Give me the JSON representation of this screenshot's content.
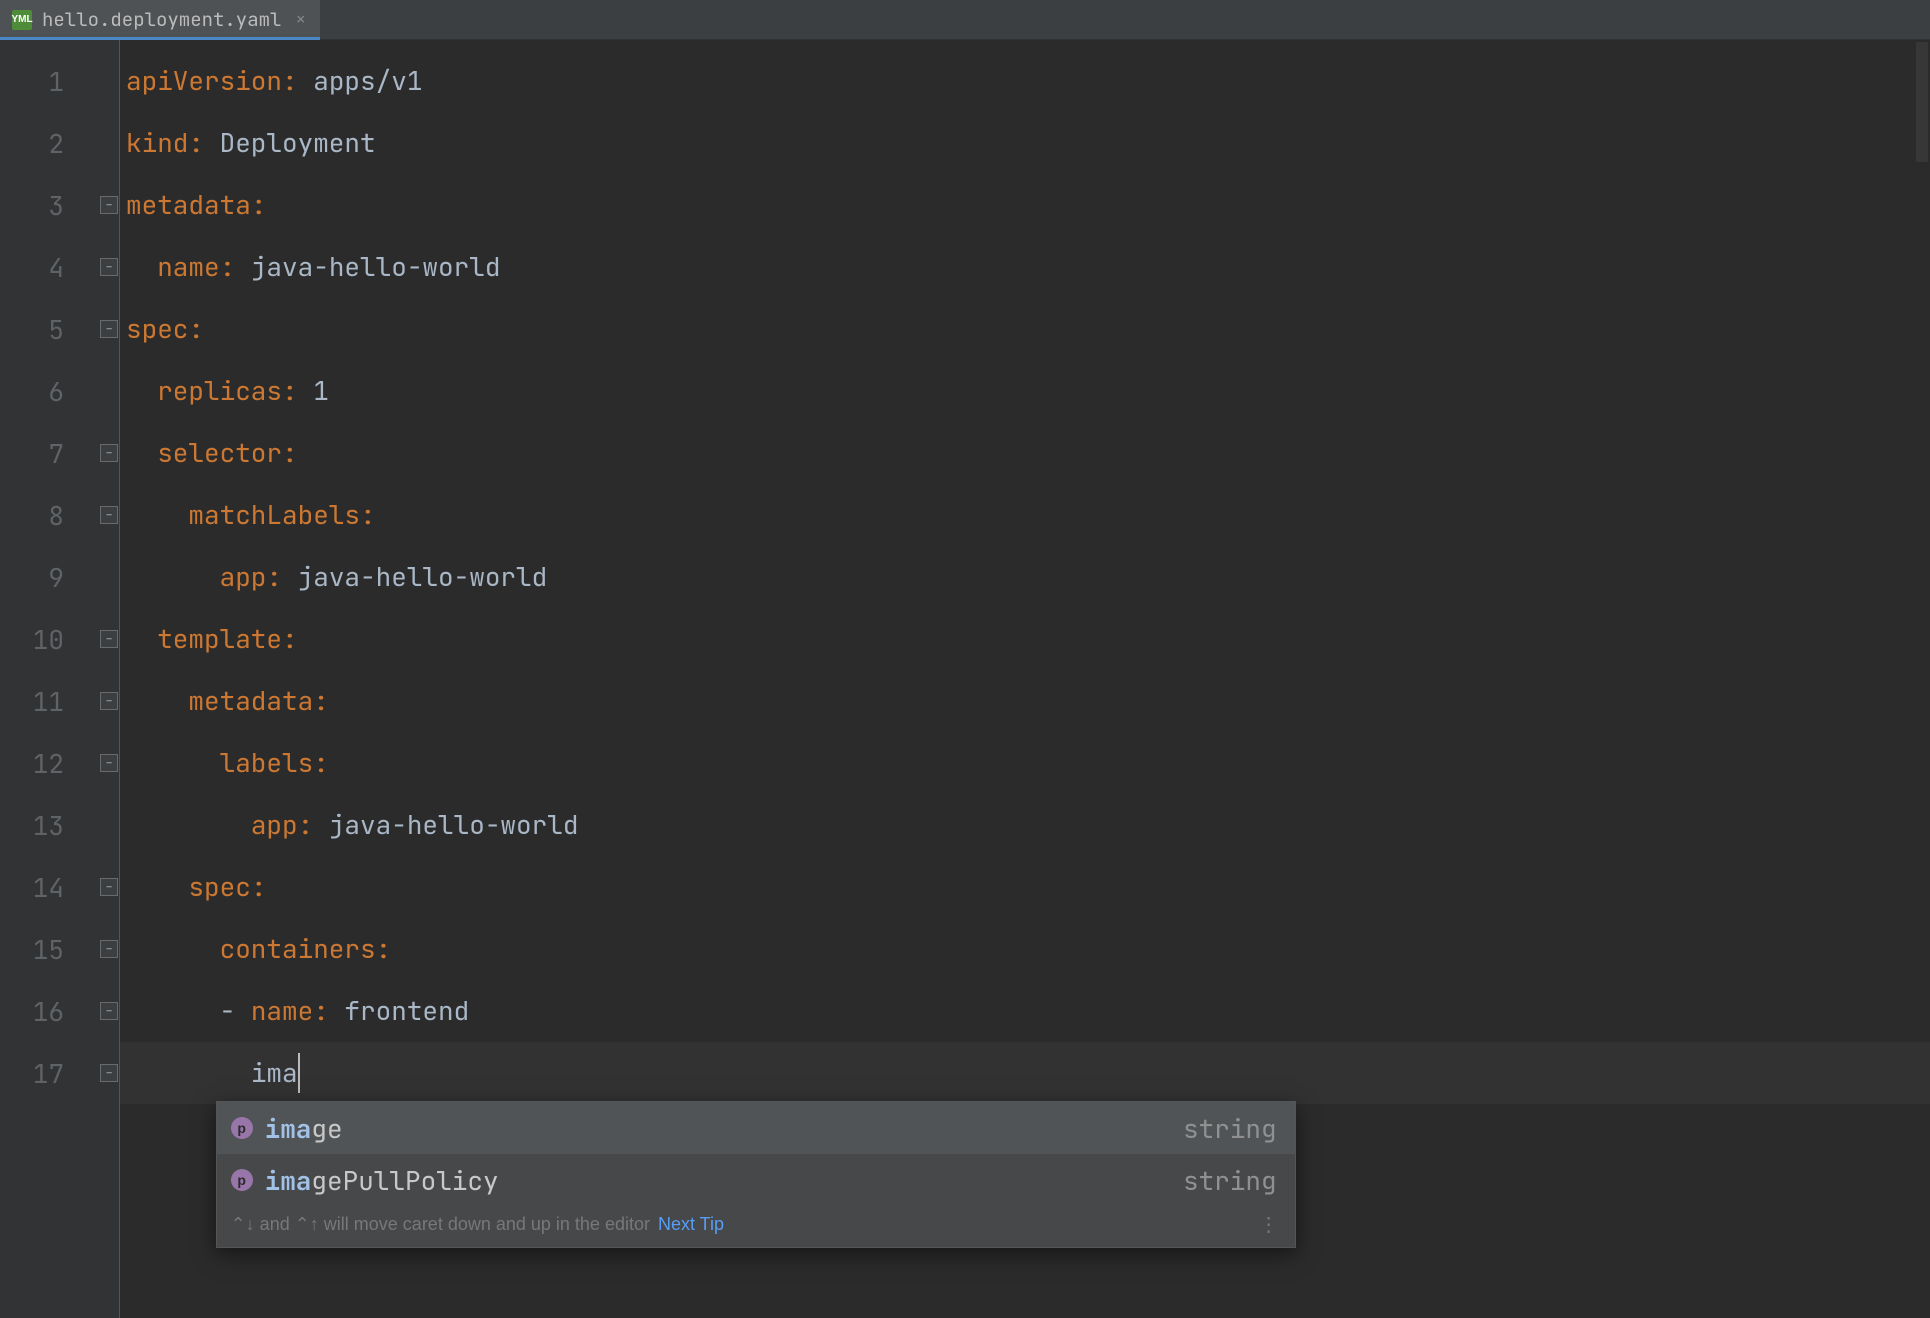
{
  "tab": {
    "icon_label": "YML",
    "filename": "hello.deployment.yaml"
  },
  "gutter": {
    "start": 1,
    "end": 17,
    "fold_lines": [
      3,
      4,
      5,
      7,
      8,
      10,
      11,
      12,
      14,
      15,
      16,
      17
    ]
  },
  "code": {
    "lines": [
      {
        "indent": "",
        "key": "apiVersion",
        "colon": ": ",
        "value": "apps/v1"
      },
      {
        "indent": "",
        "key": "kind",
        "colon": ": ",
        "value": "Deployment"
      },
      {
        "indent": "",
        "key": "metadata",
        "colon": ":",
        "value": ""
      },
      {
        "indent": "  ",
        "key": "name",
        "colon": ": ",
        "value": "java-hello-world"
      },
      {
        "indent": "",
        "key": "spec",
        "colon": ":",
        "value": ""
      },
      {
        "indent": "  ",
        "key": "replicas",
        "colon": ": ",
        "value": "1"
      },
      {
        "indent": "  ",
        "key": "selector",
        "colon": ":",
        "value": ""
      },
      {
        "indent": "    ",
        "key": "matchLabels",
        "colon": ":",
        "value": ""
      },
      {
        "indent": "      ",
        "key": "app",
        "colon": ": ",
        "value": "java-hello-world"
      },
      {
        "indent": "  ",
        "key": "template",
        "colon": ":",
        "value": ""
      },
      {
        "indent": "    ",
        "key": "metadata",
        "colon": ":",
        "value": ""
      },
      {
        "indent": "      ",
        "key": "labels",
        "colon": ":",
        "value": ""
      },
      {
        "indent": "        ",
        "key": "app",
        "colon": ": ",
        "value": "java-hello-world"
      },
      {
        "indent": "    ",
        "key": "spec",
        "colon": ":",
        "value": ""
      },
      {
        "indent": "      ",
        "key": "containers",
        "colon": ":",
        "value": ""
      },
      {
        "indent": "      ",
        "prefix": "- ",
        "key": "name",
        "colon": ": ",
        "value": "frontend"
      },
      {
        "indent": "        ",
        "partial": "ima",
        "caret": true
      }
    ],
    "current_line_index": 16
  },
  "completion": {
    "items": [
      {
        "icon": "p",
        "match": "ima",
        "rest": "ge",
        "type": "string",
        "selected": true
      },
      {
        "icon": "p",
        "match": "ima",
        "rest": "gePullPolicy",
        "type": "string",
        "selected": false
      }
    ],
    "hint_prefix": "⌃↓ and ⌃↑ will move caret down and up in the editor",
    "hint_link": "Next Tip",
    "more_glyph": "⋮"
  }
}
